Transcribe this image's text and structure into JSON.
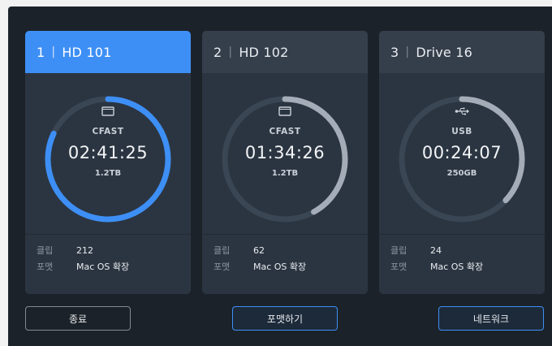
{
  "cards": [
    {
      "slot": "1",
      "name": "HD 101",
      "media_type": "CFAST",
      "media_icon": "card-icon",
      "time": "02:41:25",
      "capacity": "1.2TB",
      "remaining_fraction": 0.82,
      "arc_color": "#3d8ff5",
      "info": [
        {
          "key": "클립",
          "value": "212"
        },
        {
          "key": "포맷",
          "value": "Mac OS 확장"
        }
      ]
    },
    {
      "slot": "2",
      "name": "HD 102",
      "media_type": "CFAST",
      "media_icon": "card-icon",
      "time": "01:34:26",
      "capacity": "1.2TB",
      "remaining_fraction": 0.42,
      "arc_color": "#a4adb7",
      "info": [
        {
          "key": "클립",
          "value": "62"
        },
        {
          "key": "포맷",
          "value": "Mac OS 확장"
        }
      ]
    },
    {
      "slot": "3",
      "name": "Drive 16",
      "media_type": "USB",
      "media_icon": "usb-icon",
      "time": "00:24:07",
      "capacity": "250GB",
      "remaining_fraction": 0.37,
      "arc_color": "#a4adb7",
      "info": [
        {
          "key": "클립",
          "value": "24"
        },
        {
          "key": "포맷",
          "value": "Mac OS 확장"
        }
      ]
    }
  ],
  "buttons": {
    "exit": "종료",
    "format": "포맷하기",
    "network": "네트워크"
  },
  "colors": {
    "accent": "#3d8ff5",
    "ring_track": "#3a4654"
  }
}
